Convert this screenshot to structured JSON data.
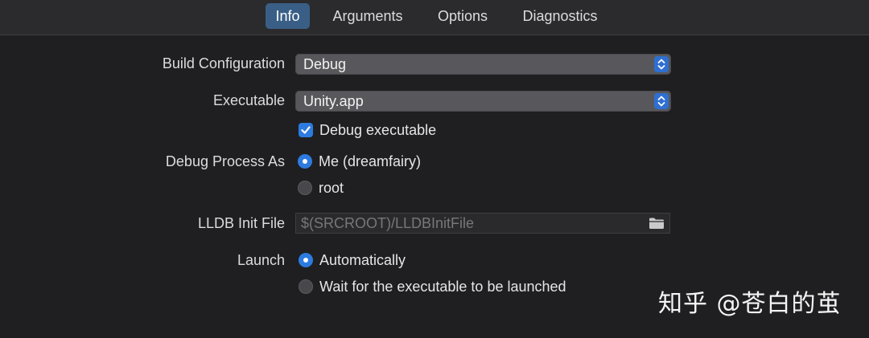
{
  "tabs": [
    {
      "label": "Info",
      "active": true
    },
    {
      "label": "Arguments",
      "active": false
    },
    {
      "label": "Options",
      "active": false
    },
    {
      "label": "Diagnostics",
      "active": false
    }
  ],
  "build_configuration": {
    "label": "Build Configuration",
    "value": "Debug"
  },
  "executable": {
    "label": "Executable",
    "value": "Unity.app",
    "debug_executable_label": "Debug executable",
    "debug_executable_checked": true
  },
  "debug_process_as": {
    "label": "Debug Process As",
    "options": [
      {
        "label": "Me (dreamfairy)",
        "selected": true
      },
      {
        "label": "root",
        "selected": false
      }
    ]
  },
  "lldb_init_file": {
    "label": "LLDB Init File",
    "placeholder": "$(SRCROOT)/LLDBInitFile",
    "value": ""
  },
  "launch": {
    "label": "Launch",
    "options": [
      {
        "label": "Automatically",
        "selected": true
      },
      {
        "label": "Wait for the executable to be launched",
        "selected": false
      }
    ]
  },
  "watermark": "知乎 @苍白的茧",
  "colors": {
    "accent": "#2d7be0",
    "background": "#1f1f21",
    "tab_active": "#3a5f86"
  }
}
